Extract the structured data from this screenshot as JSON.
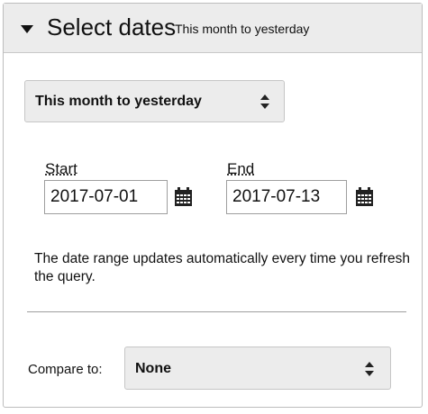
{
  "header": {
    "title": "Select dates",
    "subtitle": "This month to yesterday",
    "toggle_icon": "caret-down-icon"
  },
  "range_select": {
    "selected": "This month to yesterday",
    "icon": "select-arrows-icon"
  },
  "start": {
    "label": "Start",
    "value": "2017-07-01",
    "icon": "calendar-icon"
  },
  "end": {
    "label": "End",
    "value": "2017-07-13",
    "icon": "calendar-icon"
  },
  "note": "The date range updates automatically every time you refresh the query.",
  "compare": {
    "label": "Compare to:",
    "selected": "None",
    "icon": "select-arrows-icon"
  },
  "colors": {
    "header_bg": "#ececec",
    "select_bg": "#ececec",
    "border": "#bdbdbd",
    "text": "#111111"
  }
}
